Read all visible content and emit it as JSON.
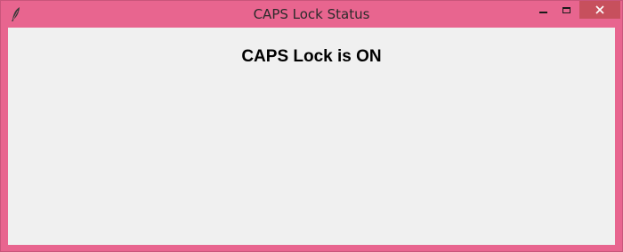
{
  "window": {
    "title": "CAPS Lock Status",
    "icon": "feather-icon",
    "frame_color": "#e8658f",
    "close_button_color": "#c7505d"
  },
  "main": {
    "status_text": "CAPS Lock is ON"
  }
}
